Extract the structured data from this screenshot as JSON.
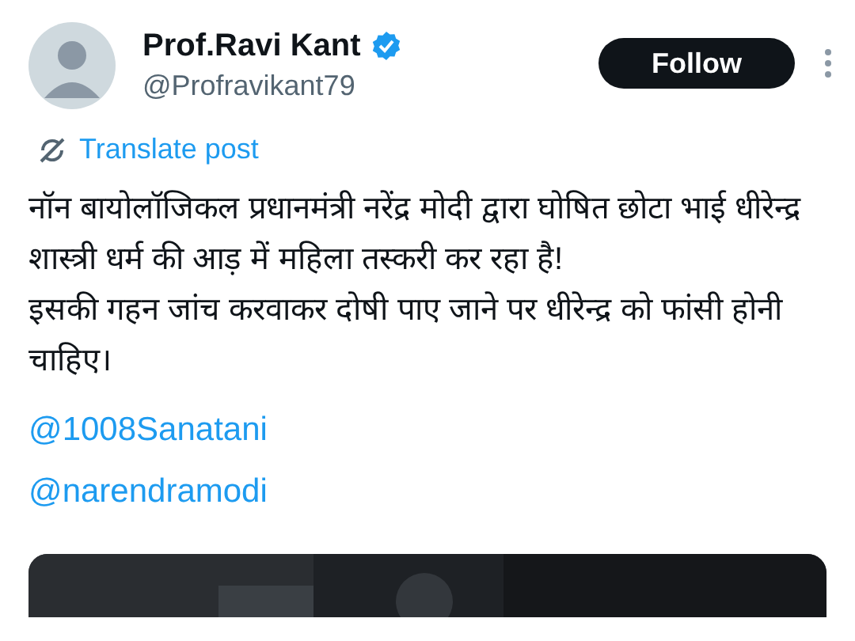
{
  "author": {
    "name": "Prof.Ravi Kant",
    "verified": true,
    "handle": "@Profravikant79"
  },
  "follow_button": "Follow",
  "translate_link": "Translate post",
  "paragraphs": [
    "नॉन बायोलॉजिकल प्रधानमंत्री नरेंद्र मोदी द्वारा घोषित छोटा भाई धीरेन्द्र शास्त्री धर्म की आड़ में महिला तस्करी कर रहा है!",
    "इसकी गहन जांच करवाकर दोषी पाए जाने पर धीरेन्द्र को फांसी होनी चाहिए।"
  ],
  "mentions": [
    "@1008Sanatani",
    "@narendramodi"
  ]
}
